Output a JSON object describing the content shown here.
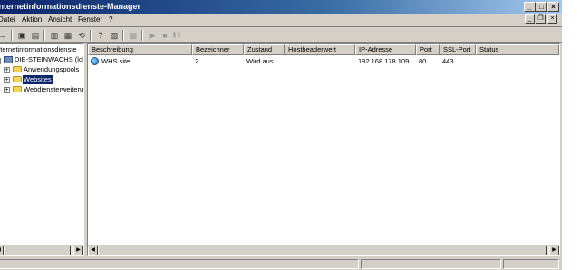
{
  "window": {
    "title": "Internetinformationsdienste-Manager",
    "controls": {
      "minimize": "_",
      "maximize": "□",
      "close": "×"
    }
  },
  "menu": {
    "items": [
      {
        "label": "Datei"
      },
      {
        "label": "Aktion"
      },
      {
        "label": "Ansicht"
      },
      {
        "label": "Fenster"
      },
      {
        "label": "?"
      }
    ],
    "mdi_controls": {
      "minimize": "_",
      "restore": "❐",
      "close": "×"
    }
  },
  "toolbar": {
    "buttons": [
      {
        "icon": "back-arrow-icon",
        "glyph": "→"
      },
      {
        "icon": "up-folder-icon",
        "glyph": "▣"
      },
      {
        "icon": "show-tree-icon",
        "glyph": "▤"
      },
      {
        "icon": "properties-icon",
        "glyph": "▥"
      },
      {
        "icon": "new-window-icon",
        "glyph": "▦"
      },
      {
        "icon": "refresh-icon",
        "glyph": "⟲"
      },
      {
        "icon": "export-list-icon",
        "glyph": "▧"
      },
      {
        "icon": "help-icon",
        "glyph": "?"
      },
      {
        "icon": "view-icon",
        "glyph": "▨"
      },
      {
        "icon": "disabled-icon",
        "glyph": "▩"
      },
      {
        "icon": "play-icon",
        "glyph": "▶"
      },
      {
        "icon": "stop-icon",
        "glyph": "■"
      },
      {
        "icon": "pause-icon",
        "glyph": "❚❚"
      }
    ]
  },
  "tree": {
    "nodes": [
      {
        "label": "Internetinformationsdienste"
      },
      {
        "label": "DIE-STEINWACHS (lokaler"
      },
      {
        "label": "Anwendungspools"
      },
      {
        "label": "Websites"
      },
      {
        "label": "Webdiensterweiterung"
      }
    ],
    "expanders": {
      "collapsed": "+",
      "expanded": "−"
    }
  },
  "list": {
    "columns": [
      {
        "label": "Beschreibung"
      },
      {
        "label": "Bezeichner"
      },
      {
        "label": "Zustand"
      },
      {
        "label": "Hostheaderwert"
      },
      {
        "label": "IP-Adresse"
      },
      {
        "label": "Port"
      },
      {
        "label": "SSL-Port"
      },
      {
        "label": "Status"
      }
    ],
    "rows": [
      {
        "icon": "website-globe-icon",
        "beschreibung": "WHS site",
        "bezeichner": "2",
        "zustand": "Wird aus...",
        "hostheaderwert": "",
        "ip": "192.168.178.109",
        "port": "80",
        "ssl_port": "443",
        "status": ""
      }
    ]
  },
  "scroll": {
    "left": "◀",
    "right": "▶"
  }
}
